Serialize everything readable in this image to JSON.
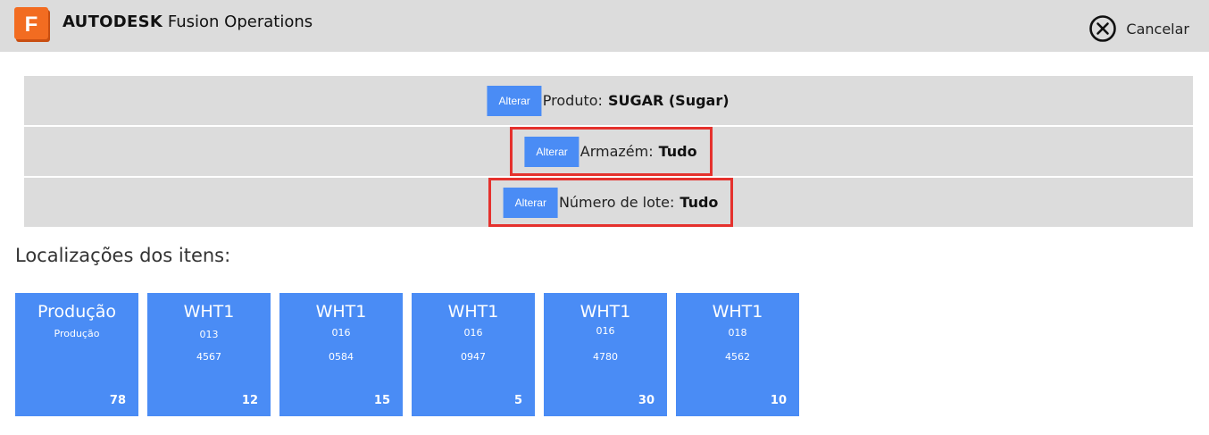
{
  "header": {
    "brand": "AUTODESK",
    "product": "Fusion Operations",
    "logo_letter": "F",
    "logo_color": "#f26c21",
    "cancel_label": "Cancelar",
    "cancel_icon": "close-circle-icon"
  },
  "filters": [
    {
      "button_label": "Alterar",
      "label": "Produto:",
      "value": "SUGAR (Sugar)",
      "highlighted": false
    },
    {
      "button_label": "Alterar",
      "label": "Armazém:",
      "value": "Tudo",
      "highlighted": true
    },
    {
      "button_label": "Alterar",
      "label": "Número de lote:",
      "value": "Tudo",
      "highlighted": true
    }
  ],
  "locations": {
    "title": "Localizações dos itens:",
    "tiles": [
      {
        "title": "Produção",
        "line1": "Produção",
        "line2": "",
        "count": "78"
      },
      {
        "title": "WHT1",
        "line1": "013",
        "line2": "4567",
        "count": "12"
      },
      {
        "title": "WHT1",
        "line1": "016",
        "line2": "0584",
        "count": "15"
      },
      {
        "title": "WHT1",
        "line1": "016",
        "line2": "0947",
        "count": "5"
      },
      {
        "title": "WHT1",
        "line1": "016",
        "line2": "4780",
        "count": "30"
      },
      {
        "title": "WHT1",
        "line1": "018",
        "line2": "4562",
        "count": "10"
      }
    ]
  },
  "colors": {
    "accent": "#4a8cf5",
    "highlight": "#e5312d",
    "panel": "#dcdcdc"
  }
}
